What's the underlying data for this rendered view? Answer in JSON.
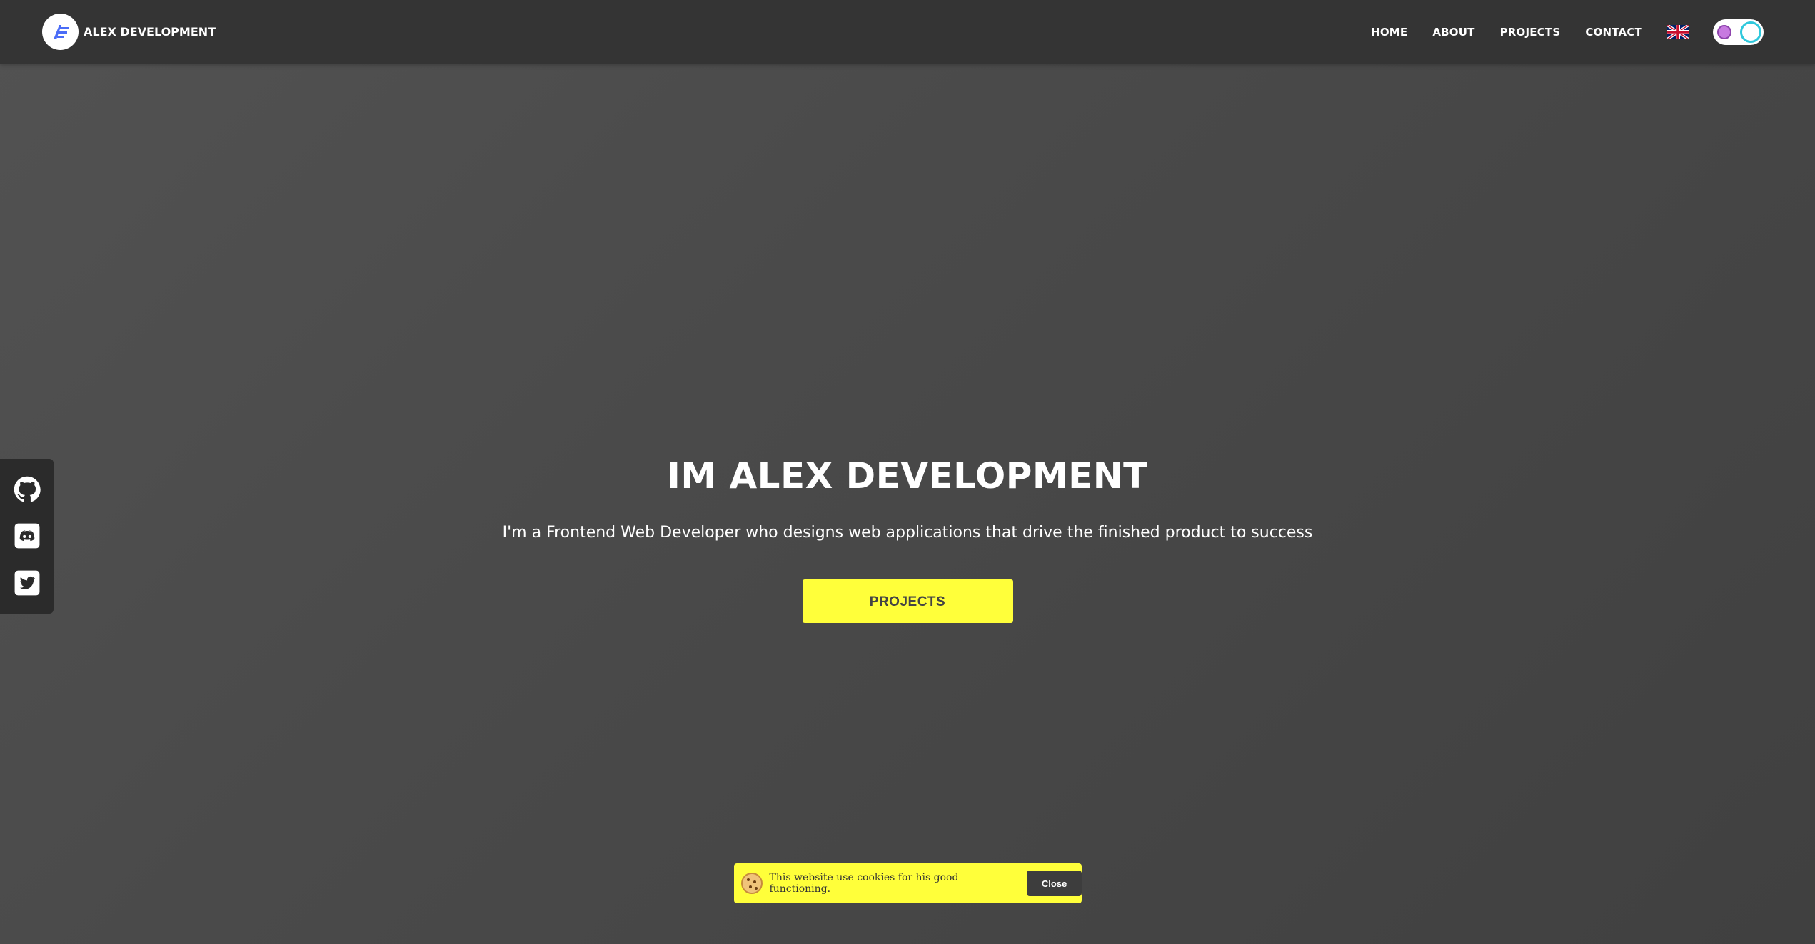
{
  "navbar": {
    "brand": "ALEX DEVELOPMENT",
    "links": [
      "HOME",
      "ABOUT",
      "PROJECTS",
      "CONTACT"
    ],
    "language_icon": "uk-flag-icon",
    "theme_toggle_icon": "moon-toggle-icon"
  },
  "social": {
    "items": [
      "github-icon",
      "discord-icon",
      "twitter-icon"
    ]
  },
  "hero": {
    "title": "IM ALEX DEVELOPMENT",
    "subtitle": "I'm a Frontend Web Developer who designs web applications that drive the finished product to success",
    "button_label": "PROJECTS"
  },
  "cookie_banner": {
    "icon": "cookie-icon",
    "text": "This website use cookies for his good functioning.",
    "close_label": "Close"
  },
  "colors": {
    "navbar_bg": "#343434",
    "accent_yellow": "#ffff3a",
    "toggle_accent": "#2fc8dc"
  }
}
